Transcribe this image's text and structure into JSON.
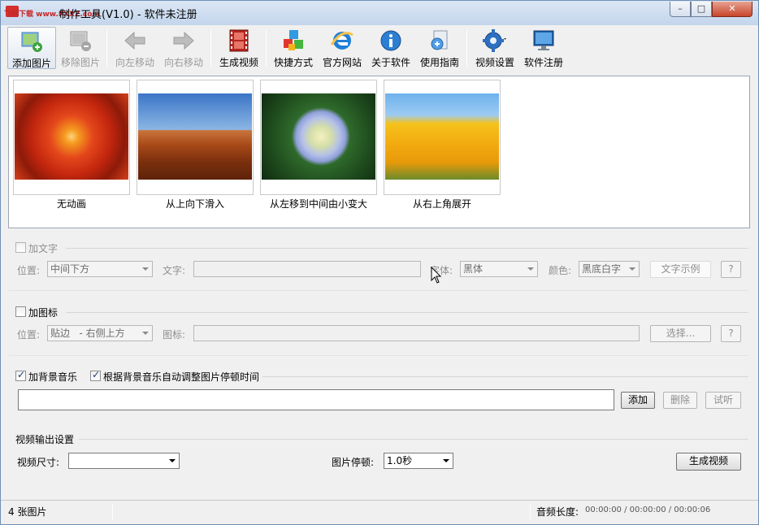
{
  "window": {
    "site_tag": "飞翔下载 www.FXXZ.com",
    "title": "制作工具(V1.0) - 软件未注册",
    "controls": {
      "minimize": "–",
      "maximize": "□",
      "close": "✕"
    }
  },
  "toolbar": {
    "buttons": [
      {
        "label": "添加图片",
        "icon": "add-image-icon",
        "enabled": true
      },
      {
        "label": "移除图片",
        "icon": "remove-image-icon",
        "enabled": false
      },
      {
        "label": "向左移动",
        "icon": "arrow-left-icon",
        "enabled": false
      },
      {
        "label": "向右移动",
        "icon": "arrow-right-icon",
        "enabled": false
      },
      {
        "label": "生成视频",
        "icon": "film-icon",
        "enabled": true
      },
      {
        "label": "快捷方式",
        "icon": "cubes-icon",
        "enabled": true
      },
      {
        "label": "官方网站",
        "icon": "ie-icon",
        "enabled": true
      },
      {
        "label": "关于软件",
        "icon": "info-icon",
        "enabled": true
      },
      {
        "label": "使用指南",
        "icon": "guide-icon",
        "enabled": true
      },
      {
        "label": "视频设置",
        "icon": "gear-icon",
        "enabled": true
      },
      {
        "label": "软件注册",
        "icon": "monitor-icon",
        "enabled": true
      }
    ]
  },
  "gallery": {
    "items": [
      {
        "caption": "无动画",
        "image": "red-chrysanthemum"
      },
      {
        "caption": "从上向下滑入",
        "image": "desert-butte"
      },
      {
        "caption": "从左移到中间由小变大",
        "image": "hydrangea"
      },
      {
        "caption": "从右上角展开",
        "image": "yellow-tulips"
      }
    ]
  },
  "text_section": {
    "checkbox_label": "加文字",
    "checked": false,
    "position_label": "位置:",
    "position_value": "中间下方",
    "text_label": "文字:",
    "text_value": "",
    "font_label": "字体:",
    "font_value": "黑体",
    "color_label": "颜色:",
    "color_value": "黑底白字",
    "sample_button": "文字示例",
    "help_button": "?"
  },
  "icon_section": {
    "checkbox_label": "加图标",
    "checked": false,
    "position_label": "位置:",
    "position_value": "贴边   - 右侧上方",
    "icon_label": "图标:",
    "icon_value": "",
    "select_button": "选择...",
    "help_button": "?"
  },
  "music_section": {
    "checkbox_label": "加背景音乐",
    "checked": true,
    "auto_label": "根据背景音乐自动调整图片停顿时间",
    "auto_checked": true,
    "path_value": "",
    "add_button": "添加",
    "delete_button": "删除",
    "preview_button": "试听"
  },
  "output_section": {
    "heading": "视频输出设置",
    "size_label": "视频尺寸:",
    "size_value": "",
    "pause_label": "图片停顿:",
    "pause_value": "1.0秒",
    "generate_button": "生成视频"
  },
  "status": {
    "count_text": "4 张图片",
    "audio_label": "音频长度:",
    "audio_value": "00:00:00 / 00:00:00 / 00:00:06"
  },
  "colors": {
    "accent": "#3a6ea5",
    "titlebar": "#c3d5ec",
    "close": "#c8452b"
  }
}
